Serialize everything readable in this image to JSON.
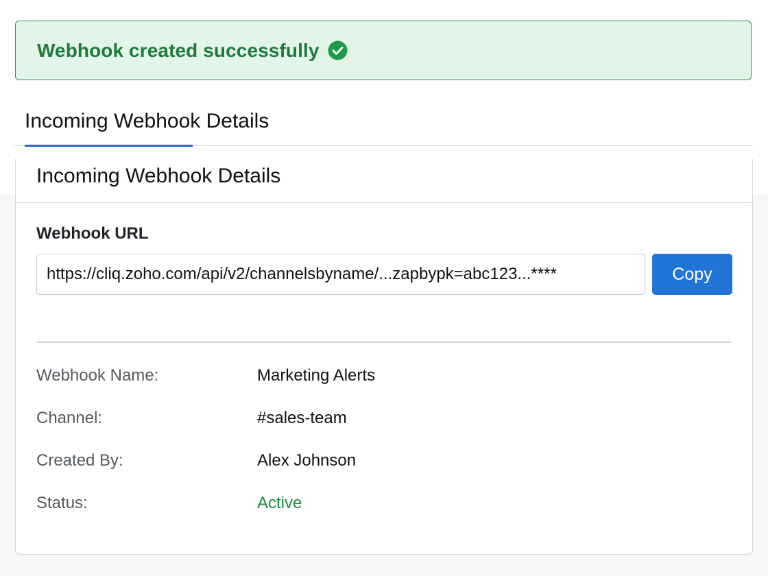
{
  "banner": {
    "message": "Webhook created successfully",
    "icon": "check-circle-icon",
    "color": "#1f7a3d",
    "background": "#e3f5e8"
  },
  "tabs": [
    {
      "label": "Incoming Webhook Details",
      "active": true
    }
  ],
  "card": {
    "title": "Incoming Webhook Details",
    "url_label": "Webhook URL",
    "url_value": "https://cliq.zoho.com/api/v2/channelsbyname/...zapbypk=abc123...****",
    "copy_label": "Copy",
    "accent": "#2275d7"
  },
  "details": [
    {
      "label": "Webhook Name:",
      "value": "Marketing Alerts"
    },
    {
      "label": "Channel:",
      "value": "#sales-team"
    },
    {
      "label": "Created By:",
      "value": "Alex Johnson"
    },
    {
      "label": "Status:",
      "value": "Active",
      "color": "#1f8a3e"
    }
  ]
}
